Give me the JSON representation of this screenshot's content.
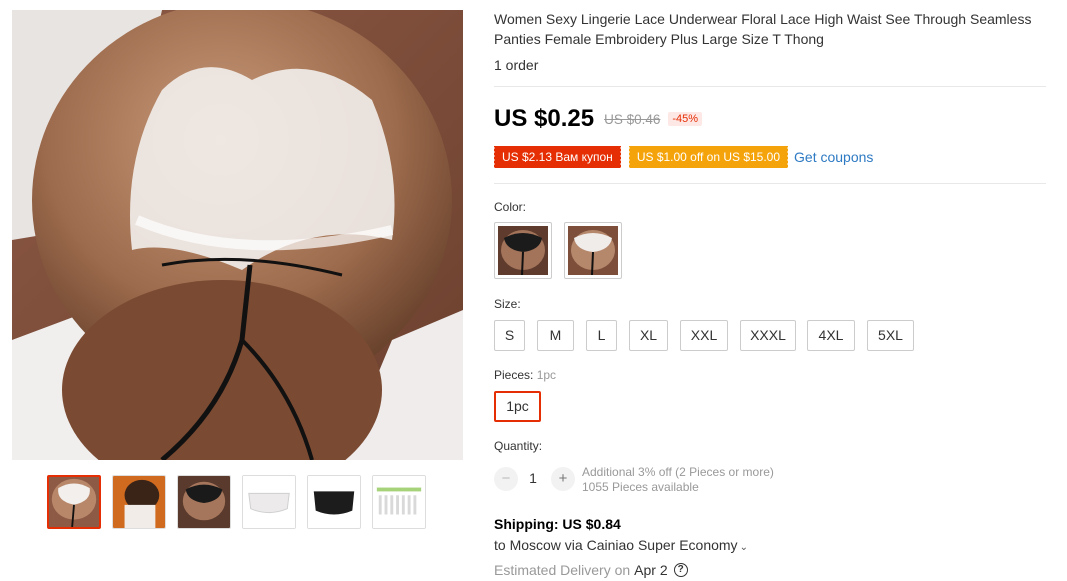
{
  "product": {
    "title": "Women Sexy Lingerie Lace Underwear Floral Lace High Waist See Through Seamless Panties Female Embroidery Plus Large Size T Thong",
    "orders": "1 order"
  },
  "price": {
    "current": "US $0.25",
    "original": "US $0.46",
    "discount": "-45%"
  },
  "coupons": {
    "items": [
      "US $2.13 Вам купон",
      "US $1.00 off on US $15.00"
    ],
    "get_label": "Get coupons"
  },
  "color": {
    "label": "Color:"
  },
  "size": {
    "label": "Size:",
    "options": [
      "S",
      "M",
      "L",
      "XL",
      "XXL",
      "XXXL",
      "4XL",
      "5XL"
    ]
  },
  "pieces": {
    "label": "Pieces:",
    "selected_value": "1pc",
    "option": "1pc"
  },
  "quantity": {
    "label": "Quantity:",
    "minus": "−",
    "plus": "+",
    "value": "1",
    "discount_note": "Additional 3% off (2 Pieces or more)",
    "available": "1055 Pieces available"
  },
  "shipping": {
    "title": "Shipping: US $0.84",
    "destination": "to Moscow via Cainiao Super Economy",
    "estimated_label": "Estimated Delivery on",
    "estimated_date": "Apr 2",
    "help": "?"
  },
  "colors": {
    "accent": "#e62e04",
    "coupon_orange": "#f5a30a",
    "link": "#2e7ac3"
  }
}
